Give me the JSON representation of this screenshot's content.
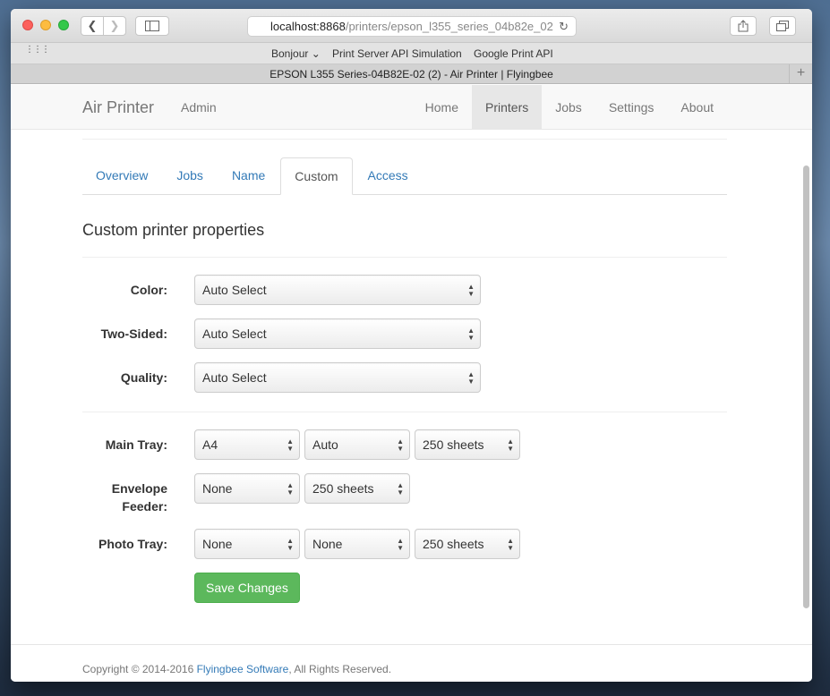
{
  "browser": {
    "address": {
      "host": "localhost:8868",
      "path": "/printers/epson_l355_series_04b82e_02"
    },
    "bookmarks": [
      {
        "label": "Bonjour ⌄"
      },
      {
        "label": "Print Server API Simulation"
      },
      {
        "label": "Google Print API"
      }
    ],
    "tab_title": "EPSON L355 Series-04B82E-02 (2) - Air Printer | Flyingbee"
  },
  "navbar": {
    "brand": "Air Printer",
    "admin": "Admin",
    "items": [
      {
        "label": "Home"
      },
      {
        "label": "Printers",
        "active": true
      },
      {
        "label": "Jobs"
      },
      {
        "label": "Settings"
      },
      {
        "label": "About"
      }
    ]
  },
  "tabs": [
    {
      "label": "Overview"
    },
    {
      "label": "Jobs"
    },
    {
      "label": "Name"
    },
    {
      "label": "Custom",
      "active": true
    },
    {
      "label": "Access"
    }
  ],
  "section_title": "Custom printer properties",
  "properties": {
    "color": {
      "label": "Color:",
      "value": "Auto Select"
    },
    "two_sided": {
      "label": "Two-Sided:",
      "value": "Auto Select"
    },
    "quality": {
      "label": "Quality:",
      "value": "Auto Select"
    }
  },
  "trays": {
    "main": {
      "label": "Main Tray:",
      "size": "A4",
      "type": "Auto",
      "capacity": "250 sheets"
    },
    "envelope": {
      "label_line1": "Envelope",
      "label_line2": "Feeder:",
      "size": "None",
      "capacity": "250 sheets"
    },
    "photo": {
      "label": "Photo Tray:",
      "size": "None",
      "type": "None",
      "capacity": "250 sheets"
    }
  },
  "save_button": "Save Changes",
  "footer": {
    "prefix": "Copyright © 2014-2016 ",
    "link": "Flyingbee Software",
    "suffix": ", All Rights Reserved."
  }
}
